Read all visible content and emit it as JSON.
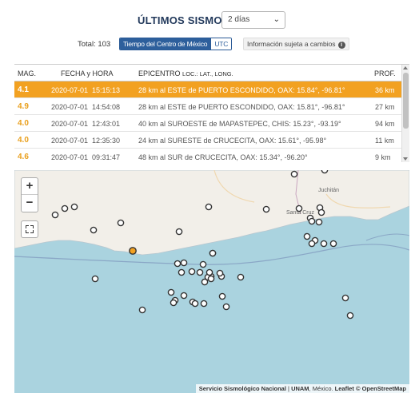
{
  "header": {
    "title": "ÚLTIMOS SISMOS",
    "range_value": "2 días"
  },
  "summary": {
    "total_label": "Total: 103",
    "tz_active": "Tiempo del Centro de México",
    "tz_other": "UTC",
    "notice": "Información sujeta a cambios",
    "notice_icon": "info-icon"
  },
  "table": {
    "columns": {
      "mag": "MAG.",
      "datetime": "FECHA y HORA",
      "epicenter": "EPICENTRO",
      "epicenter_sub": "LOC.: LAT., LONG.",
      "depth": "PROF."
    },
    "rows": [
      {
        "mag": "4.1",
        "date": "2020-07-01",
        "time": "15:15:13",
        "location": "28 km al ESTE de PUERTO ESCONDIDO, OAX: 15.84°, -96.81°",
        "depth": "36 km",
        "selected": true
      },
      {
        "mag": "4.9",
        "date": "2020-07-01",
        "time": "14:54:08",
        "location": "28 km al ESTE de PUERTO ESCONDIDO, OAX: 15.81°, -96.81°",
        "depth": "27 km",
        "selected": false
      },
      {
        "mag": "4.0",
        "date": "2020-07-01",
        "time": "12:43:01",
        "location": "40 km al SUROESTE de MAPASTEPEC, CHIS: 15.23°, -93.19°",
        "depth": "94 km",
        "selected": false
      },
      {
        "mag": "4.0",
        "date": "2020-07-01",
        "time": "12:35:30",
        "location": "24 km al SURESTE de CRUCECITA, OAX: 15.61°, -95.98°",
        "depth": "11 km",
        "selected": false
      },
      {
        "mag": "4.6",
        "date": "2020-07-01",
        "time": "09:31:47",
        "location": "48 km al SUR de CRUCECITA, OAX: 15.34°, -96.20°",
        "depth": "9 km",
        "selected": false
      }
    ],
    "selected_color": "#f2a121",
    "mag_color": "#e99f1c"
  },
  "map": {
    "zoom_in": "+",
    "zoom_out": "−",
    "fullscreen_icon": "fullscreen-icon",
    "cities": {
      "juchitan": "Juchitán",
      "santa_cruz": "Santa Cruz"
    },
    "attribution": {
      "source": "Servicio Sismológico Nacional",
      "institution": "UNAM",
      "country": "México",
      "leaflet": "Leaflet",
      "osm": "© OpenStreetMap"
    },
    "land_color": "#f2efe9",
    "sea_color": "#aad3df",
    "marker_color": "#f2a121"
  }
}
